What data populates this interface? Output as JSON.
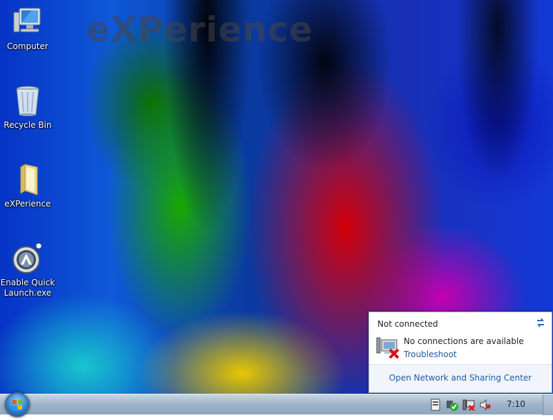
{
  "wallpaper": {
    "watermark": "eXPerience"
  },
  "desktop_icons": [
    {
      "label": "Computer",
      "icon": "computer-icon"
    },
    {
      "label": "Recycle Bin",
      "icon": "recycle-bin-icon"
    },
    {
      "label": "eXPerience",
      "icon": "folder-icon"
    },
    {
      "label": "Enable Quick Launch.exe",
      "icon": "aimp-icon"
    }
  ],
  "network_flyout": {
    "title": "Not connected",
    "message": "No connections are available",
    "troubleshoot_link": "Troubleshoot",
    "footer_link": "Open Network and Sharing Center"
  },
  "taskbar": {
    "clock": "7:10",
    "tray_icons": [
      "action-center-icon",
      "security-check-icon",
      "network-disconnected-icon",
      "volume-muted-icon"
    ]
  }
}
